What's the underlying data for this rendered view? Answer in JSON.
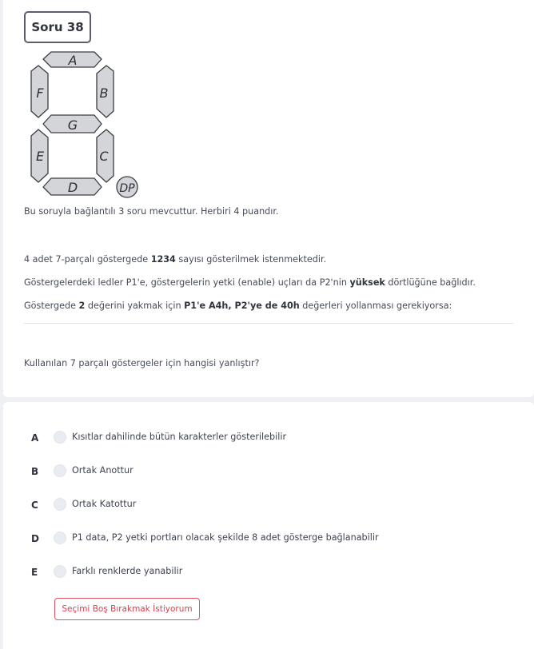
{
  "question": {
    "title": "Soru 38",
    "segments": {
      "a": "A",
      "b": "B",
      "c": "C",
      "d": "D",
      "e": "E",
      "f": "F",
      "g": "G",
      "dp": "DP"
    },
    "info": "Bu soruyla bağlantılı 3 soru mevcuttur. Herbiri 4 puandır.",
    "line1": {
      "before": "4 adet 7-parçalı göstergede ",
      "bold": "1234",
      "after": " sayısı gösterilmek istenmektedir."
    },
    "line2": {
      "before": "Göstergelerdeki ledler P1'e, göstergelerin yetki (enable) uçları da P2'nin ",
      "bold": "yüksek",
      "after": " dörtlüğüne bağlıdır."
    },
    "line3": {
      "before": "Göstergede ",
      "bold1": "2",
      "middle": " değerini yakmak için ",
      "bold2": "P1'e A4h, P2'ye de 40h",
      "after": " değerleri yollanması gerekiyorsa:"
    },
    "prompt": "Kullanılan 7 parçalı göstergeler için hangisi yanlıştır?"
  },
  "options": [
    {
      "letter": "A",
      "text": "Kısıtlar dahilinde bütün karakterler gösterilebilir"
    },
    {
      "letter": "B",
      "text": "Ortak Anottur"
    },
    {
      "letter": "C",
      "text": "Ortak Katottur"
    },
    {
      "letter": "D",
      "text": "P1 data, P2 yetki portları olacak şekilde 8 adet gösterge bağlanabilir"
    },
    {
      "letter": "E",
      "text": "Farklı renklerde yanabilir"
    }
  ],
  "leave_blank_label": "Seçimi Boş Bırakmak İstiyorum"
}
